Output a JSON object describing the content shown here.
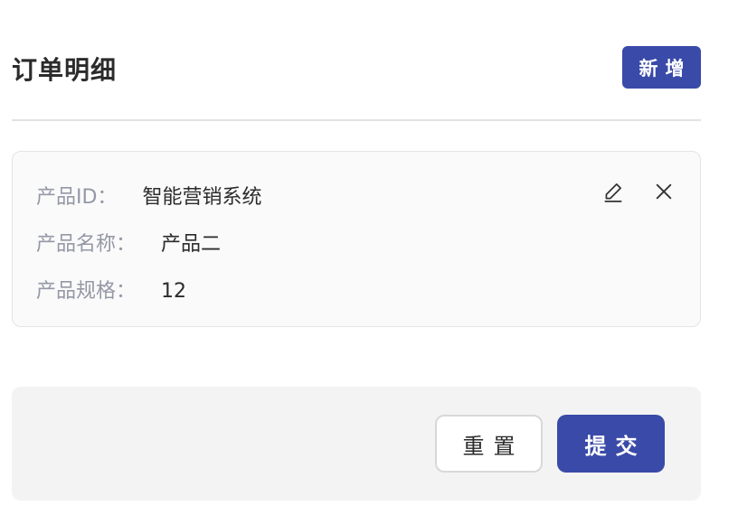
{
  "header": {
    "title": "订单明细",
    "add_label": "新增"
  },
  "detail": {
    "fields": [
      {
        "label": "产品ID：",
        "value": "智能营销系统"
      },
      {
        "label": "产品名称：",
        "value": "产品二"
      },
      {
        "label": "产品规格：",
        "value": "12"
      }
    ],
    "edit_icon": "pencil-icon",
    "delete_icon": "close-icon"
  },
  "footer": {
    "reset_label": "重置",
    "submit_label": "提交"
  },
  "colors": {
    "primary": "#3a4aa8",
    "label": "#9498a6",
    "divider": "#e3e3e3",
    "card_bg": "#fafafa",
    "footer_bg": "#f3f3f3"
  }
}
